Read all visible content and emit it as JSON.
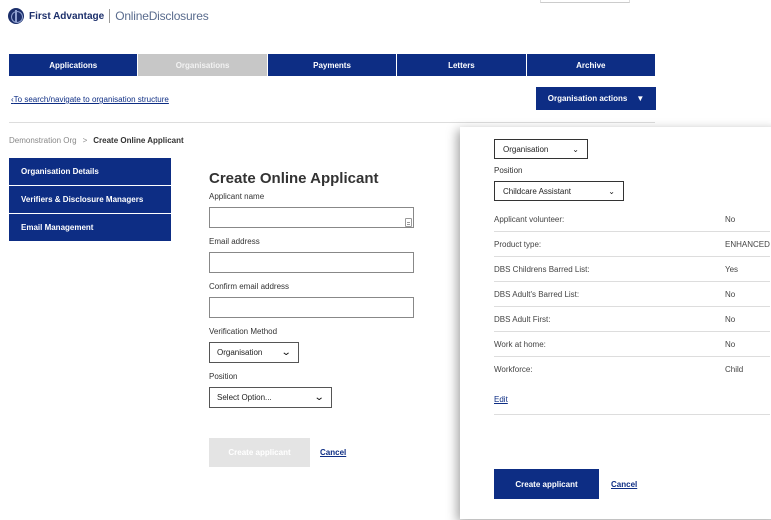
{
  "brand": {
    "name": "First Advantage",
    "product": "OnlineDisclosures"
  },
  "nav": {
    "tabs": [
      {
        "label": "Applications",
        "active": false
      },
      {
        "label": "Organisations",
        "active": true
      },
      {
        "label": "Payments",
        "active": false
      },
      {
        "label": "Letters",
        "active": false
      },
      {
        "label": "Archive",
        "active": false
      }
    ]
  },
  "toolbar": {
    "back_link": "To search/navigate to organisation structure",
    "org_actions": "Organisation actions"
  },
  "breadcrumb": {
    "parent": "Demonstration Org",
    "separator": ">",
    "current": "Create Online Applicant"
  },
  "sidebar": {
    "items": [
      {
        "label": "Organisation Details"
      },
      {
        "label": "Verifiers & Disclosure Managers"
      },
      {
        "label": "Email Management"
      }
    ]
  },
  "form": {
    "title": "Create Online Applicant",
    "applicant_name_label": "Applicant name",
    "applicant_name_value": "",
    "email_label": "Email address",
    "email_value": "",
    "confirm_email_label": "Confirm email address",
    "confirm_email_value": "",
    "verification_label": "Verification Method",
    "verification_value": "Organisation",
    "position_label": "Position",
    "position_value": "Select Option...",
    "submit_label": "Create applicant",
    "cancel_label": "Cancel"
  },
  "panel": {
    "verification_value": "Organisation",
    "position_label": "Position",
    "position_value": "Childcare Assistant",
    "rows": [
      {
        "label": "Applicant volunteer:",
        "value": "No"
      },
      {
        "label": "Product type:",
        "value": "ENHANCED"
      },
      {
        "label": "DBS Childrens Barred List:",
        "value": "Yes"
      },
      {
        "label": "DBS Adult's Barred List:",
        "value": "No"
      },
      {
        "label": "DBS Adult First:",
        "value": "No"
      },
      {
        "label": "Work at home:",
        "value": "No"
      },
      {
        "label": "Workforce:",
        "value": "Child"
      }
    ],
    "edit_label": "Edit",
    "submit_label": "Create applicant",
    "cancel_label": "Cancel"
  },
  "icons": {
    "back": "chevron-left-icon",
    "org_actions": "triangle-down-icon",
    "select": "chevron-down-icon",
    "logo": "globe-logo-icon",
    "field": "key-icon"
  },
  "colors": {
    "primary": "#0d2d84",
    "tab_inactive": "#c7c7c7",
    "disabled_button": "#e4e4e4"
  }
}
